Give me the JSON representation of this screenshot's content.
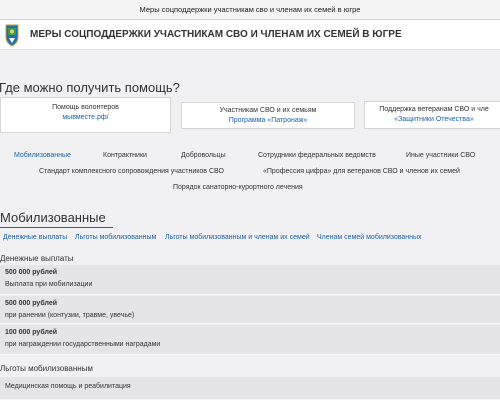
{
  "window": {
    "title": "Меры соцподдержки участникам сво и членам их семей в югре"
  },
  "header": {
    "title": "МЕРЫ СОЦПОДДЕРЖКИ УЧАСТНИКАМ СВО И ЧЛЕНАМ ИХ СЕМЕЙ В ЮГРЕ",
    "emblem_icon": "coat-of-arms-icon"
  },
  "help": {
    "title": "Где можно получить помощь?",
    "cards": [
      {
        "label": "Помощь волонтеров",
        "link": "мывместе.рф/"
      },
      {
        "label": "Участникам СВО и их семьям",
        "link": "Программа «Патронаж»"
      },
      {
        "label": "Поддержка ветеранам СВО и чле",
        "link": "«Защитники Отечества»"
      }
    ]
  },
  "nav": {
    "items": [
      "Мобилизованные",
      "Контрактники",
      "Добровольцы",
      "Сотрудники федеральных ведомств",
      "Иные участники СВО",
      "Стандарт комплексного сопровождения участников СВО",
      "«Профессия цифра» для ветеранов СВО и членов их семей",
      "Порядок санаторно-курортного лечения"
    ],
    "active_index": 0
  },
  "section": {
    "title": "Мобилизованные",
    "subnav": [
      "Денежные выплаты",
      "Льготы мобилизованным",
      "Льготы мобилизованным и членам их семей",
      "Членам семей мобилизованных"
    ]
  },
  "payments": {
    "title": "Денежные выплаты",
    "rows": [
      {
        "amount": "500 000 рублей",
        "desc": "Выплата при мобилизации"
      },
      {
        "amount": "500 000 рублей",
        "desc": "при ранении (контузии, травме, увечье)"
      },
      {
        "amount": "100 000 рублей",
        "desc": "при награждении государственными наградами"
      }
    ]
  },
  "benefits": {
    "title": "Льготы мобилизованным",
    "rows": [
      {
        "label": "Медицинская помощь и реабилитация"
      }
    ]
  },
  "colors": {
    "accent": "#1c62a8",
    "background": "#f1f1f3",
    "row": "#e5e5e8"
  }
}
